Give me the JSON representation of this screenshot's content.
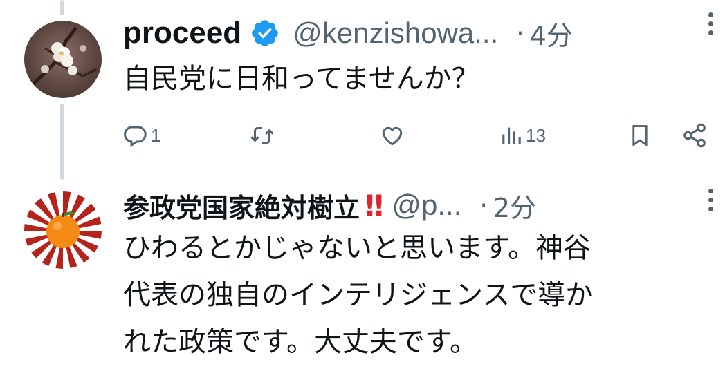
{
  "tweets": [
    {
      "display_name": "proceed",
      "verified": true,
      "handle": "@kenzishowa...",
      "separator": "·",
      "time": "4分",
      "text": "自民党に日和ってませんか？",
      "avatar": "plum-blossom-photo",
      "actions": {
        "reply_count": "1",
        "views_count": "13"
      }
    },
    {
      "display_name": "参政党国家絶対樹立",
      "emoji": "‼",
      "handle": "@p...",
      "separator": "·",
      "time": "2分",
      "text": "ひわるとかじゃないと思います。神谷\n代表の独自のインテリジェンスで導か\nれた政策です。大丈夫です。",
      "avatar": "orange-rising-sun"
    }
  ],
  "colors": {
    "secondary_text": "#536471",
    "verified_blue": "#1d9bf0",
    "thread_line": "#cfd9de",
    "emoji_red": "#e0242c",
    "sunburst_red": "#b5241c",
    "orange": "#f28a14"
  }
}
